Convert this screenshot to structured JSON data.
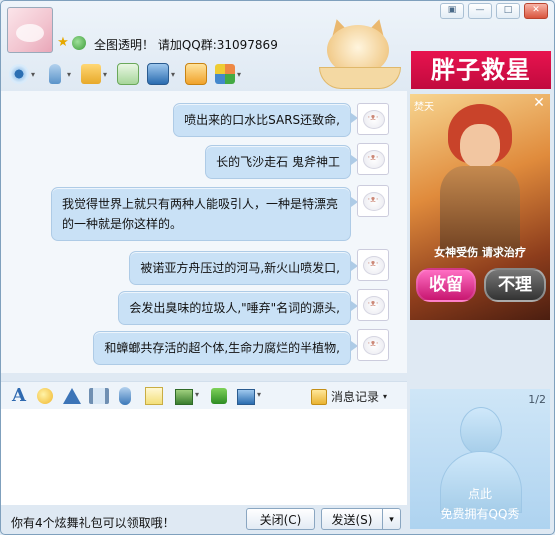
{
  "header": {
    "signature": "全图透明！ 请加QQ群:31097869",
    "banner_text": "胖子救星"
  },
  "messages": [
    {
      "text": "喷出来的口水比SARS还致命,"
    },
    {
      "text": "长的飞沙走石 鬼斧神工"
    },
    {
      "text": "我觉得世界上就只有两种人能吸引人，一种是特漂亮的一种就是你这样的。"
    },
    {
      "text": "被诺亚方舟压过的河马,新火山喷发口,"
    },
    {
      "text": "会发出臭味的垃圾人,\"唾弃\"名词的源头,"
    },
    {
      "text": "和蟑螂共存活的超个体,生命力腐烂的半植物,"
    }
  ],
  "ad": {
    "brand": "焚天",
    "slogan": "女神受伤  请求治疗",
    "keep_label": "收留",
    "ignore_label": "不理"
  },
  "format_bar": {
    "font_icon_glyph": "A",
    "history_label": "消息记录"
  },
  "bottom": {
    "notice": "你有4个炫舞礼包可以领取哦！",
    "close_label": "关闭(C)",
    "send_label": "发送(S)"
  },
  "show_panel": {
    "page": "1/2",
    "line1": "点此",
    "line2": "免费拥有QQ秀"
  },
  "colors": {
    "bubble": "#c9e1f6",
    "banner": "#d50f47",
    "accent": "#2f6ab0"
  }
}
